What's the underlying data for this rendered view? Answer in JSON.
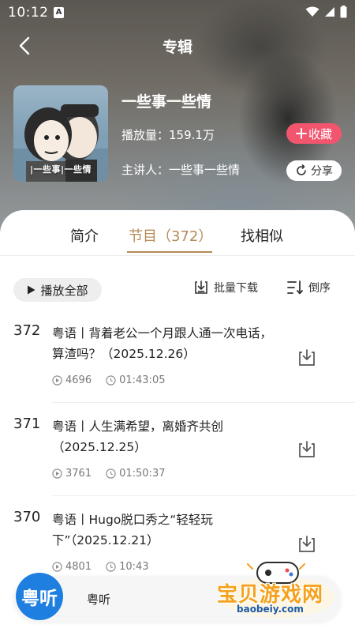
{
  "status_bar": {
    "time": "10:12",
    "notification_icon": "A"
  },
  "nav": {
    "title": "专辑"
  },
  "album": {
    "cover_caption": "|一些事|一些情",
    "title": "一些事一些情",
    "plays": "播放量：159.1万",
    "speaker": "主讲人：一些事一些情",
    "favorite_label": "收藏",
    "share_label": "分享"
  },
  "tabs": [
    {
      "label": "简介",
      "active": false
    },
    {
      "label": "节目（372）",
      "active": true
    },
    {
      "label": "找相似",
      "active": false
    }
  ],
  "toolbar": {
    "play_all": "播放全部",
    "batch_download": "批量下载",
    "reverse_order": "倒序"
  },
  "episodes": [
    {
      "num": "372",
      "title": "粤语丨背着老公一个月跟人通一次电话，算渣吗？（2025.12.26）",
      "plays": "4696",
      "duration": "01:43:05"
    },
    {
      "num": "371",
      "title": "粤语丨人生满希望，离婚齐共创（2025.12.25）",
      "plays": "3761",
      "duration": "01:50:37"
    },
    {
      "num": "370",
      "title": "粤语丨Hugo脱口秀之“轻轻玩下”（2025.12.21）",
      "plays": "4801",
      "duration": "10:43"
    }
  ],
  "mini_player": {
    "logo_text": "粤听",
    "title": "粤听"
  },
  "watermark": {
    "text": "宝贝游戏网",
    "url": "baobeiy.com"
  },
  "colors": {
    "accent": "#b58a55",
    "favorite": "#f2566f",
    "player_logo": "#1f7fe0"
  }
}
